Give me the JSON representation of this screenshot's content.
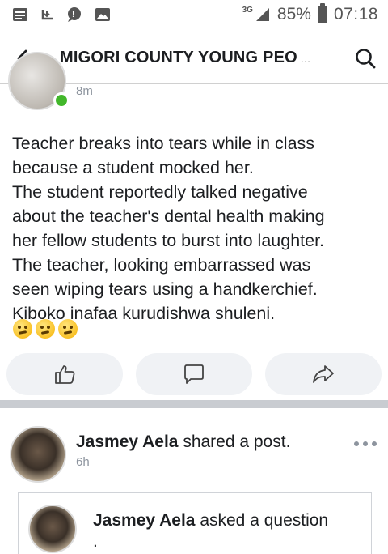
{
  "status_bar": {
    "network": "3G",
    "battery": "85%",
    "time": "07:18"
  },
  "header": {
    "title": "MIGORI COUNTY YOUNG PEO",
    "ellipsis": "..."
  },
  "post1": {
    "time": "8m",
    "lines": [
      "Teacher breaks into tears while in class",
      "because a student mocked her.",
      "The student reportedly talked negative",
      "about the teacher's dental health making",
      "her fellow students to burst into laughter.",
      "The teacher, looking embarrassed was",
      "seen wiping tears using a handkerchief.",
      "Kiboko inafaa kurudishwa shuleni."
    ],
    "emoji_count": 3,
    "actions": {
      "like_icon": "thumbs-up-icon",
      "comment_icon": "comment-icon",
      "share_icon": "share-icon"
    }
  },
  "post2": {
    "author": "Jasmey Aela",
    "action": " shared a post.",
    "time": "6h",
    "shared": {
      "author": "Jasmey Aela",
      "action": " asked a question",
      "continuation": "."
    }
  },
  "colors": {
    "online": "#42b72a",
    "action_bg": "#f0f2f5",
    "divider": "#c9ccd1",
    "muted": "#8d949e"
  }
}
